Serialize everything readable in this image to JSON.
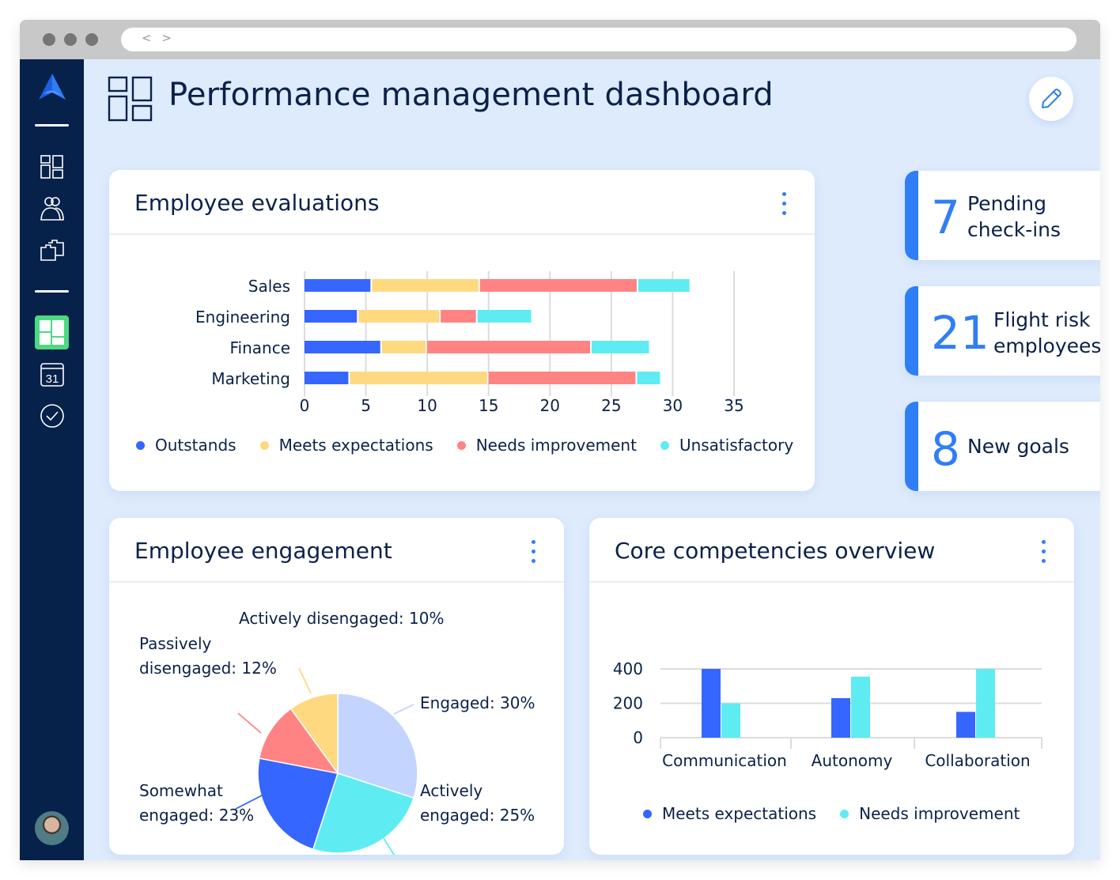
{
  "browser": {
    "nav_glyph": "< >",
    "window_dots": [
      "#767676",
      "#767676",
      "#767676"
    ]
  },
  "sidebar": {
    "logo": "app-logo",
    "items": [
      {
        "icon": "dashboard-grid-icon",
        "active": false
      },
      {
        "icon": "people-icon",
        "active": false
      },
      {
        "icon": "folders-icon",
        "active": false
      },
      {
        "icon": "dashboard-layout-icon",
        "active": true
      },
      {
        "icon": "calendar-icon",
        "label": "31",
        "active": false
      },
      {
        "icon": "check-circle-icon",
        "active": false
      }
    ],
    "avatar": "user-avatar"
  },
  "header": {
    "title": "Performance management dashboard",
    "edit_icon": "pencil-icon"
  },
  "colors": {
    "accent": "#2f7ef5",
    "navy": "#06214a",
    "outstands": "#3566ff",
    "meets": "#ffd97f",
    "needs": "#ff8383",
    "unsatisfactory": "#5eecf2",
    "engaged": "#c3d4ff",
    "active_nav": "#4cd982"
  },
  "stats": [
    {
      "value": "7",
      "label_line1": "Pending",
      "label_line2": "check-ins"
    },
    {
      "value": "21",
      "label_line1": "Flight risk",
      "label_line2": "employees"
    },
    {
      "value": "8",
      "label_line1": "New goals",
      "label_line2": ""
    }
  ],
  "cards": {
    "evaluations": {
      "title": "Employee evaluations"
    },
    "engagement": {
      "title": "Employee engagement"
    },
    "competencies": {
      "title": "Core competencies overview"
    }
  },
  "chart_data": [
    {
      "type": "bar",
      "orientation": "horizontal",
      "stacked": true,
      "title": "Employee evaluations",
      "categories": [
        "Sales",
        "Engineering",
        "Finance",
        "Marketing"
      ],
      "series": [
        {
          "name": "Outstands",
          "color": "#3566ff",
          "values": [
            5.5,
            4.4,
            6.3,
            3.7
          ]
        },
        {
          "name": "Meets expectations",
          "color": "#ffd97f",
          "values": [
            8.8,
            6.7,
            3.7,
            11.3
          ]
        },
        {
          "name": "Needs improvement",
          "color": "#ff8383",
          "values": [
            12.9,
            3.0,
            13.4,
            12.1
          ]
        },
        {
          "name": "Unsatisfactory",
          "color": "#5eecf2",
          "values": [
            4.3,
            4.5,
            4.8,
            2.0
          ]
        }
      ],
      "xlim": [
        0,
        35
      ],
      "xticks": [
        "0",
        "5",
        "10",
        "15",
        "20",
        "25",
        "30",
        "35"
      ],
      "grid": true,
      "legend": "bottom"
    },
    {
      "type": "pie",
      "title": "Employee engagement",
      "slices": [
        {
          "name": "Engaged",
          "value": 30,
          "label": "Engaged: 30%",
          "color": "#c3d4ff"
        },
        {
          "name": "Actively engaged",
          "value": 25,
          "label_line1": "Actively",
          "label_line2": "engaged: 25%",
          "color": "#5eecf2"
        },
        {
          "name": "Somewhat engaged",
          "value": 23,
          "label_line1": "Somewhat",
          "label_line2": "engaged: 23%",
          "color": "#3566ff"
        },
        {
          "name": "Passively disengaged",
          "value": 12,
          "label_line1": "Passively",
          "label_line2": "disengaged: 12%",
          "color": "#ff8383"
        },
        {
          "name": "Actively disengaged",
          "value": 10,
          "label": "Actively disengaged: 10%",
          "color": "#ffd97f"
        }
      ]
    },
    {
      "type": "bar",
      "orientation": "vertical",
      "title": "Core competencies overview",
      "categories": [
        "Communication",
        "Autonomy",
        "Collaboration"
      ],
      "series": [
        {
          "name": "Meets expectations",
          "color": "#3566ff",
          "values": [
            400,
            230,
            150
          ]
        },
        {
          "name": "Needs improvement",
          "color": "#5eecf2",
          "values": [
            200,
            355,
            400
          ]
        }
      ],
      "ylim": [
        0,
        400
      ],
      "yticks": [
        "0",
        "200",
        "400"
      ],
      "grid": true,
      "legend": "bottom"
    }
  ]
}
